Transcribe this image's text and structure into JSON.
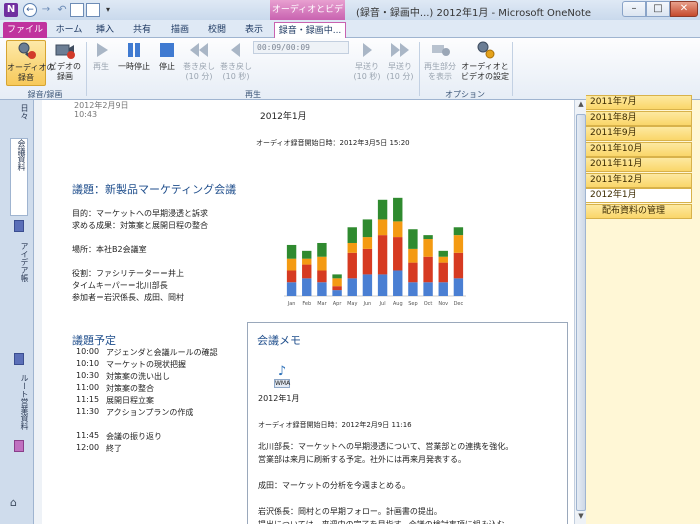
{
  "titlebar": {
    "app_letter": "N",
    "contextual_tab_group": "オーディオとビデオ",
    "window_title": "(録音・録画中...) 2012年1月 - Microsoft OneNote",
    "min": "–",
    "max": "□",
    "close": "✕"
  },
  "tabs": {
    "file": "ファイル",
    "home": "ホーム",
    "insert": "挿入",
    "share": "共有",
    "draw": "描画",
    "review": "校閲",
    "view": "表示",
    "recording": "録音・録画中..."
  },
  "ribbon": {
    "audio_record": "オーディオの\n録音",
    "video_record": "ビデオの\n録画",
    "group_record": "録音/録画",
    "play": "再生",
    "pause": "一時停止",
    "stop": "停止",
    "rewind10m": "巻き戻し\n(10 分)",
    "rewind10s": "巻き戻し\n(10 秒)",
    "time": "00:09/00:09",
    "forward10s": "早送り\n(10 秒)",
    "forward10m": "早送り\n(10 分)",
    "group_play": "再生",
    "show_playback_section": "再生部分\nを表示",
    "audio_video_settings": "オーディオと\nビデオの設定",
    "group_options": "オプション"
  },
  "leftpane": {
    "tab1": "日々",
    "tab2": "会議資料",
    "tab3": "アイデア帳",
    "tab4": "ルート営業資料"
  },
  "page": {
    "date": "2012年2月9日",
    "time": "10:43",
    "title": "2012年1月",
    "audio_start": "オーディオ録音開始日時：2012年3月5日 15:20",
    "agenda_heading": "議題：新製品マーケティング会議",
    "purpose": "目的：マーケットへの早期浸透と訴求",
    "outcome": "求める成果：対策案と展開日程の整合",
    "place": "場所：本社B2会議室",
    "facilitator_label": "役割：ファシリテーター＝井上",
    "timekeeper": "タイムキーパー＝北川部長",
    "attendees": "参加者＝岩沢係長、成田、岡村",
    "schedule_heading": "議題予定",
    "schedule": [
      {
        "time": "10:00",
        "item": "アジェンダと会議ルールの確認"
      },
      {
        "time": "10:10",
        "item": "マーケットの現状把握"
      },
      {
        "time": "10:30",
        "item": "対策案の洗い出し"
      },
      {
        "time": "11:00",
        "item": "対策案の整合"
      },
      {
        "time": "11:15",
        "item": "展開日程立案"
      },
      {
        "time": "11:30",
        "item": "アクションプランの作成"
      },
      {
        "time": "11:45",
        "item": "会議の振り返り"
      },
      {
        "time": "12:00",
        "item": "終了"
      }
    ],
    "memo_heading": "会議メモ",
    "wma_label": "WMA",
    "file_date": "2012年1月",
    "memo_audio_start": "オーディオ録音開始日時：2012年2月9日 11:16",
    "memo_lines": [
      "北川部長：マーケットへの早期浸透について、営業部との連携を強化。",
      "営業部は来月に刷新する予定。社外には再来月発表する。",
      "",
      "成田：マーケットの分析を今週まとめる。",
      "",
      "岩沢係長：岡村との早期フォロー。計画書の提出。",
      "提出については、来週中の完了を目指す。会議の検討事項に組み込む。"
    ]
  },
  "chart_data": {
    "type": "bar",
    "categories": [
      "Jan",
      "Feb",
      "Mar",
      "Apr",
      "May",
      "Jun",
      "Jul",
      "Aug",
      "Sep",
      "Oct",
      "Nov",
      "Dec"
    ],
    "series": [
      {
        "values": [
          7,
          9,
          7,
          3,
          9,
          11,
          11,
          13,
          7,
          7,
          7,
          9
        ]
      },
      {
        "values": [
          6,
          7,
          6,
          2,
          13,
          13,
          20,
          17,
          10,
          13,
          10,
          13
        ]
      },
      {
        "values": [
          6,
          3,
          7,
          4,
          5,
          6,
          8,
          8,
          7,
          9,
          3,
          9
        ]
      },
      {
        "values": [
          7,
          4,
          7,
          2,
          8,
          9,
          10,
          12,
          10,
          2,
          3,
          4
        ]
      }
    ],
    "colors": [
      "#4a7fd3",
      "#d63a21",
      "#f49a12",
      "#2f8a2f"
    ],
    "ylim": [
      0,
      55
    ]
  },
  "rightpane": {
    "pages": [
      {
        "label": "2011年7月",
        "selected": false
      },
      {
        "label": "2011年8月",
        "selected": false
      },
      {
        "label": "2011年9月",
        "selected": false
      },
      {
        "label": "2011年10月",
        "selected": false
      },
      {
        "label": "2011年11月",
        "selected": false
      },
      {
        "label": "2011年12月",
        "selected": false
      },
      {
        "label": "2012年1月",
        "selected": true
      },
      {
        "label": "配布資料の管理",
        "selected": false
      }
    ]
  }
}
